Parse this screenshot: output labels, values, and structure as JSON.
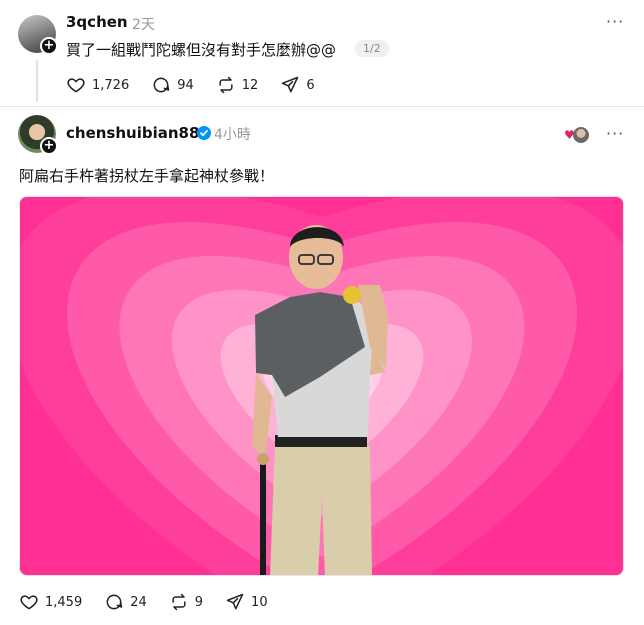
{
  "posts": [
    {
      "username": "3qchen",
      "time": "2天",
      "text": "買了一組戰鬥陀螺但沒有對手怎麼辦@@",
      "pager": "1/2",
      "stats": {
        "likes": "1,726",
        "comments": "94",
        "reposts": "12",
        "shares": "6"
      }
    },
    {
      "username": "chenshuibian88",
      "time": "4小時",
      "text": "阿扁右手杵著拐杖左手拿起神杖參戰！",
      "stats": {
        "likes": "1,459",
        "comments": "24",
        "reposts": "9",
        "shares": "10"
      }
    }
  ],
  "icons": {
    "more": "more-icon",
    "like": "heart-icon",
    "comment": "comment-icon",
    "repost": "repost-icon",
    "share": "share-icon",
    "verified": "verified-badge-icon",
    "follow": "plus-icon"
  },
  "colors": {
    "accent_verified": "#0095f6",
    "background_pink": "#ff2f93",
    "muted_text": "#999999",
    "liked_heart": "#e0245e"
  }
}
